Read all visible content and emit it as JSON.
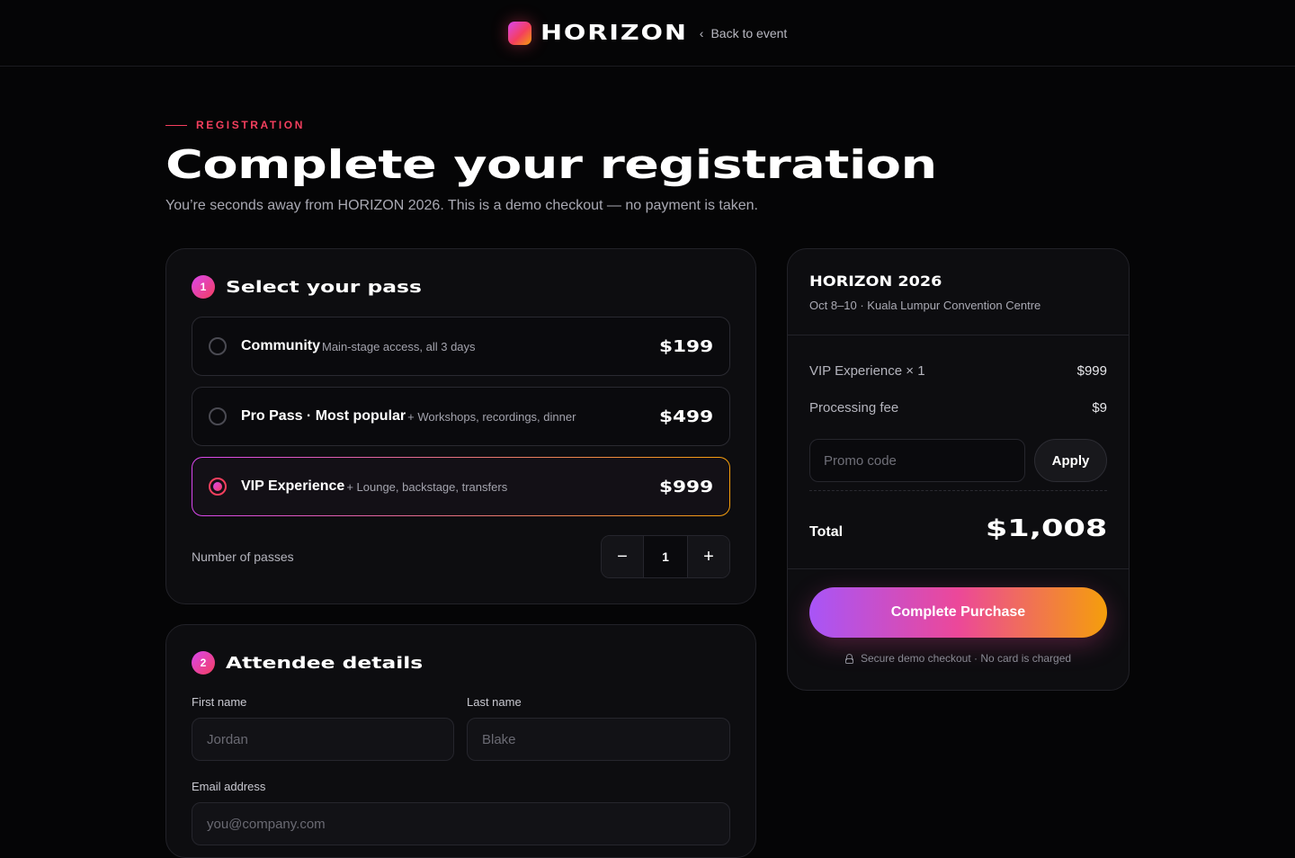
{
  "header": {
    "brand": "HORIZON",
    "back_label": "Back to event",
    "back_icon": "chevron-left-icon"
  },
  "hero": {
    "eyebrow": "REGISTRATION",
    "title": "Complete your registration",
    "subtitle": "You’re seconds away from HORIZON 2026. This is a demo checkout — no payment is taken."
  },
  "pass_section": {
    "step": "1",
    "title": "Select your pass",
    "options": [
      {
        "name": "Community",
        "desc": "Main-stage access, all 3 days",
        "price": "$199",
        "selected": false
      },
      {
        "name": "Pro Pass · Most popular",
        "desc": "+ Workshops, recordings, dinner",
        "price": "$499",
        "selected": false
      },
      {
        "name": "VIP Experience",
        "desc": "+ Lounge, backstage, transfers",
        "price": "$999",
        "selected": true
      }
    ],
    "quantity_label": "Number of passes",
    "quantity": "1",
    "decrement": "−",
    "increment": "+"
  },
  "attendee_section": {
    "step": "2",
    "title": "Attendee details",
    "first_name_label": "First name",
    "first_name_placeholder": "Jordan",
    "last_name_label": "Last name",
    "last_name_placeholder": "Blake",
    "email_label": "Email address",
    "email_placeholder": "you@company.com"
  },
  "summary": {
    "title": "HORIZON 2026",
    "subtitle": "Oct 8–10 · Kuala Lumpur Convention Centre",
    "line_item_label": "VIP Experience × 1",
    "line_item_amount": "$999",
    "fee_label": "Processing fee",
    "fee_amount": "$9",
    "promo_placeholder": "Promo code",
    "apply_label": "Apply",
    "total_label": "Total",
    "total_amount": "$1,008",
    "purchase_label": "Complete Purchase",
    "secure_note": "Secure demo checkout · No card is charged"
  },
  "colors": {
    "accent": "#f43f5e",
    "gradient_start": "#a855f7",
    "gradient_mid": "#ec4899",
    "gradient_end": "#f59e0b",
    "background": "#050506"
  }
}
